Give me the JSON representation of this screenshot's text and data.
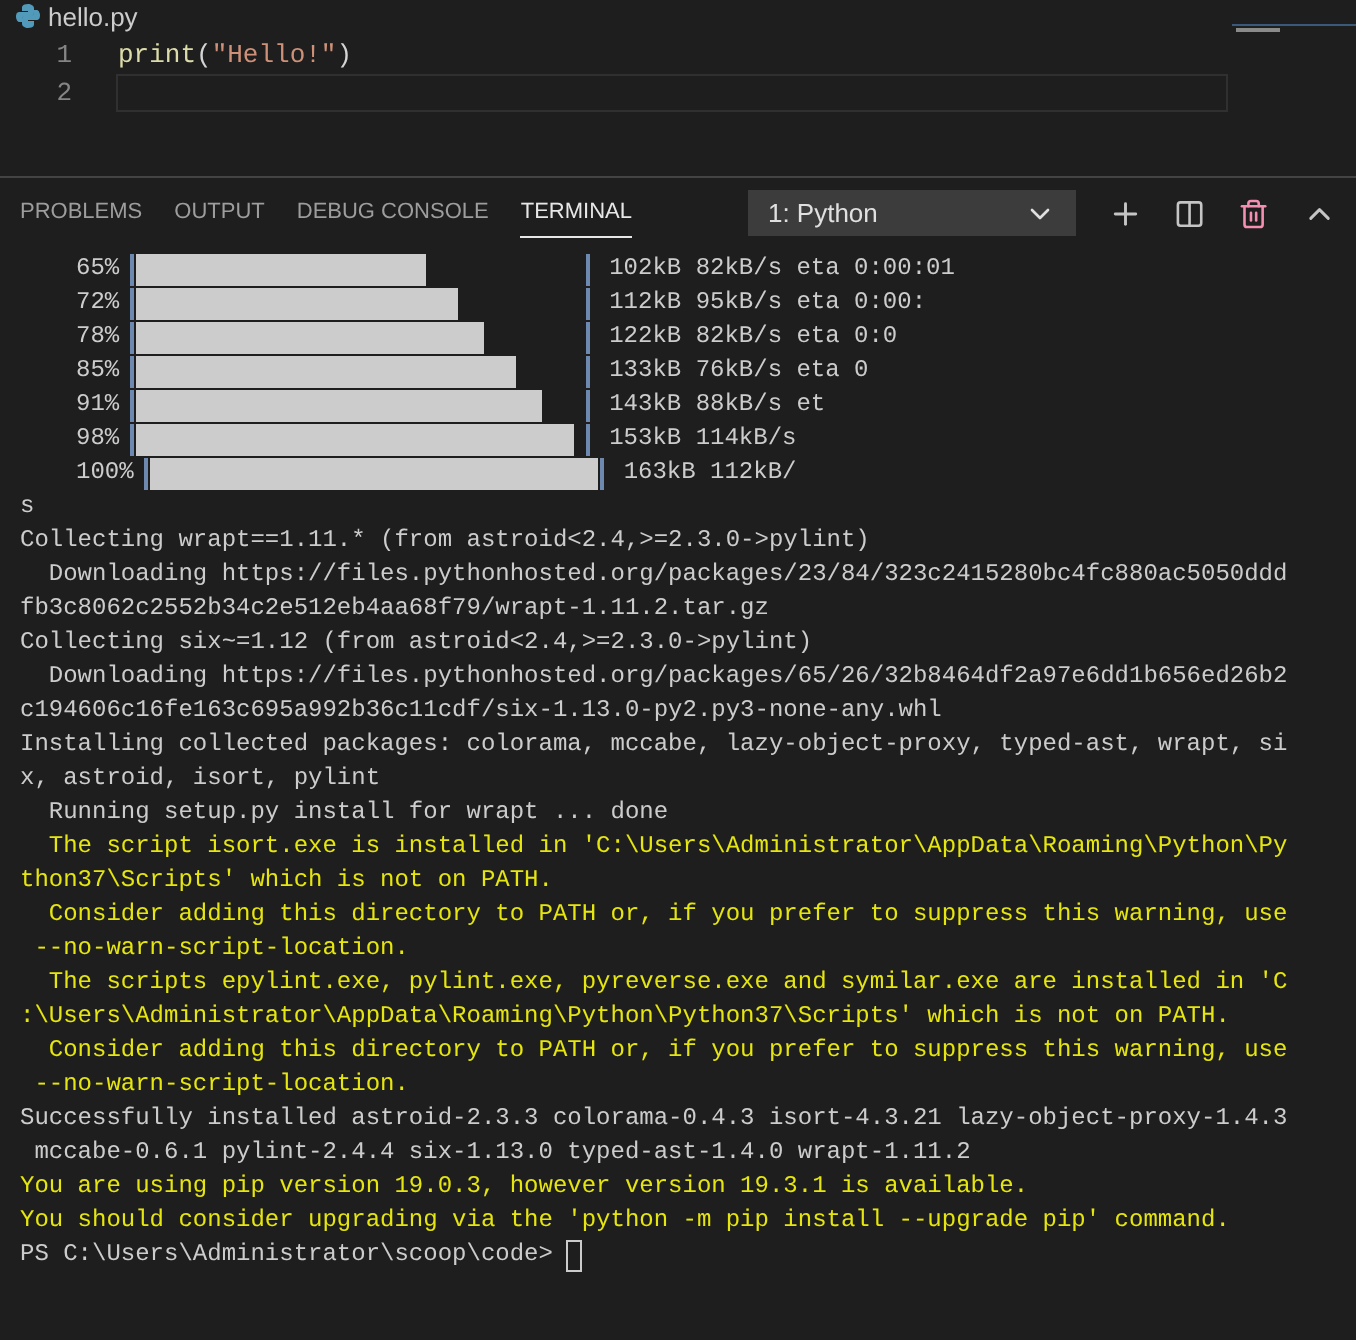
{
  "editor": {
    "tab": {
      "label": "hello.py"
    },
    "lines": [
      {
        "number": "1",
        "tokens": [
          {
            "kind": "function",
            "text": "print"
          },
          {
            "kind": "plain",
            "text": "("
          },
          {
            "kind": "string",
            "text": "\"Hello!\""
          },
          {
            "kind": "plain",
            "text": ")"
          }
        ]
      },
      {
        "number": "2",
        "current": true
      }
    ]
  },
  "panel": {
    "tabs": [
      {
        "label": "PROBLEMS",
        "selected": false
      },
      {
        "label": "OUTPUT",
        "selected": false
      },
      {
        "label": "DEBUG CONSOLE",
        "selected": false
      },
      {
        "label": "TERMINAL",
        "selected": true
      }
    ],
    "terminal_select": {
      "value": "1: Python"
    }
  },
  "terminal": {
    "progress": [
      {
        "percent": "65%",
        "level": 0.65,
        "reading": "102kB 82kB/s eta 0:00:01"
      },
      {
        "percent": "72%",
        "level": 0.72,
        "reading": "112kB 95kB/s eta 0:00:"
      },
      {
        "percent": "78%",
        "level": 0.78,
        "reading": "122kB 82kB/s eta 0:0"
      },
      {
        "percent": "85%",
        "level": 0.85,
        "reading": "133kB 76kB/s eta 0"
      },
      {
        "percent": "91%",
        "level": 0.91,
        "reading": "143kB 88kB/s et"
      },
      {
        "percent": "98%",
        "level": 0.98,
        "reading": "153kB 114kB/s"
      },
      {
        "percent": "100%",
        "level": 1,
        "reading": "163kB 112kB/"
      }
    ],
    "lines": [
      {
        "kind": "normal",
        "text": "s"
      },
      {
        "kind": "normal",
        "text": "Collecting wrapt==1.11.* (from astroid<2.4,>=2.3.0->pylint)"
      },
      {
        "kind": "normal",
        "text": "  Downloading https://files.pythonhosted.org/packages/23/84/323c2415280bc4fc880ac5050ddd"
      },
      {
        "kind": "normal",
        "text": "fb3c8062c2552b34c2e512eb4aa68f79/wrapt-1.11.2.tar.gz"
      },
      {
        "kind": "normal",
        "text": "Collecting six~=1.12 (from astroid<2.4,>=2.3.0->pylint)"
      },
      {
        "kind": "normal",
        "text": "  Downloading https://files.pythonhosted.org/packages/65/26/32b8464df2a97e6dd1b656ed26b2"
      },
      {
        "kind": "normal",
        "text": "c194606c16fe163c695a992b36c11cdf/six-1.13.0-py2.py3-none-any.whl"
      },
      {
        "kind": "normal",
        "text": "Installing collected packages: colorama, mccabe, lazy-object-proxy, typed-ast, wrapt, si"
      },
      {
        "kind": "normal",
        "text": "x, astroid, isort, pylint"
      },
      {
        "kind": "normal",
        "text": "  Running setup.py install for wrapt ... done"
      },
      {
        "kind": "warning",
        "text": "  The script isort.exe is installed in 'C:\\Users\\Administrator\\AppData\\Roaming\\Python\\Py"
      },
      {
        "kind": "warning",
        "text": "thon37\\Scripts' which is not on PATH."
      },
      {
        "kind": "warning",
        "text": "  Consider adding this directory to PATH or, if you prefer to suppress this warning, use"
      },
      {
        "kind": "warning",
        "text": " --no-warn-script-location."
      },
      {
        "kind": "warning",
        "text": "  The scripts epylint.exe, pylint.exe, pyreverse.exe and symilar.exe are installed in 'C"
      },
      {
        "kind": "warning",
        "text": ":\\Users\\Administrator\\AppData\\Roaming\\Python\\Python37\\Scripts' which is not on PATH."
      },
      {
        "kind": "warning",
        "text": "  Consider adding this directory to PATH or, if you prefer to suppress this warning, use"
      },
      {
        "kind": "warning",
        "text": " --no-warn-script-location."
      },
      {
        "kind": "normal",
        "text": "Successfully installed astroid-2.3.3 colorama-0.4.3 isort-4.3.21 lazy-object-proxy-1.4.3"
      },
      {
        "kind": "normal",
        "text": " mccabe-0.6.1 pylint-2.4.4 six-1.13.0 typed-ast-1.4.0 wrapt-1.11.2"
      },
      {
        "kind": "warning",
        "text": "You are using pip version 19.0.3, however version 19.3.1 is available."
      },
      {
        "kind": "warning",
        "text": "You should consider upgrading via the 'python -m pip install --upgrade pip' command."
      }
    ],
    "prompt": "PS C:\\Users\\Administrator\\scoop\\code>"
  }
}
